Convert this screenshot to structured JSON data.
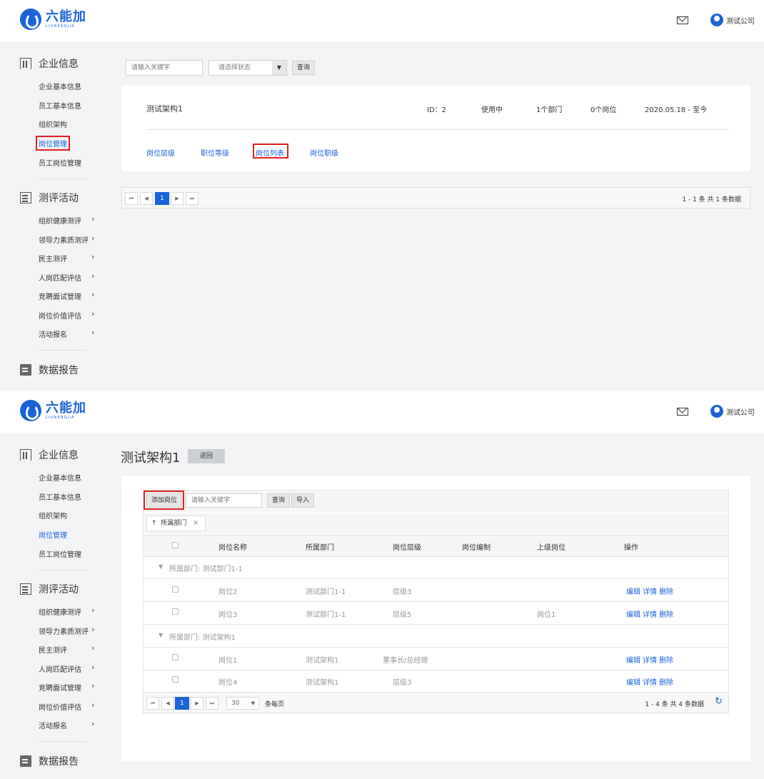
{
  "header": {
    "logo_cn": "六能加",
    "logo_en": "LIUNENGJIA",
    "user_name": "测试公司"
  },
  "sidebar": {
    "section1": {
      "title": "企业信息",
      "items": [
        "企业基本信息",
        "员工基本信息",
        "组织架构",
        "岗位管理",
        "员工岗位管理"
      ]
    },
    "section2": {
      "title": "测评活动",
      "items": [
        "组织健康测评",
        "领导力素质测评",
        "民主测评",
        "人岗匹配评估",
        "竞聘面试管理",
        "岗位价值评估",
        "活动报名"
      ]
    },
    "section3": {
      "title": "数据报告"
    },
    "chevron": "›"
  },
  "screen1": {
    "search_placeholder": "请输入关键字",
    "status_placeholder": "请选择状态",
    "query_label": "查询",
    "card": {
      "name": "测试架构1",
      "id": "ID：2",
      "status": "使用中",
      "departments": "1个部门",
      "positions": "0个岗位",
      "date": "2020.05.18 - 至今",
      "tabs": [
        "岗位层级",
        "职位等级",
        "岗位列表",
        "岗位职级"
      ]
    },
    "pager": {
      "page": "1",
      "summary": "1 - 1 条   共 1 条数据"
    }
  },
  "screen2": {
    "title": "测试架构1",
    "back_label": "返回",
    "add_label": "添加岗位",
    "search_placeholder": "请输入关键字",
    "query_label": "查询",
    "import_label": "导入",
    "group_chip": "所属部门",
    "columns": [
      "岗位名称",
      "所属部门",
      "岗位层级",
      "岗位编制",
      "上级岗位",
      "操作"
    ],
    "groups": [
      {
        "label": "所属部门: 测试部门1-1",
        "rows": [
          {
            "name": "岗位2",
            "dept": "测试部门1-1",
            "level": "层级3",
            "quota": "",
            "parent": ""
          },
          {
            "name": "岗位3",
            "dept": "测试部门1-1",
            "level": "层级5",
            "quota": "",
            "parent": "岗位1"
          }
        ]
      },
      {
        "label": "所属部门: 测试架构1",
        "rows": [
          {
            "name": "岗位1",
            "dept": "测试架构1",
            "level": "董事长/总经理",
            "quota": "",
            "parent": ""
          },
          {
            "name": "岗位4",
            "dept": "测试架构1",
            "level": "层级3",
            "quota": "",
            "parent": ""
          }
        ]
      }
    ],
    "ops": [
      "编辑",
      "详情",
      "删除"
    ],
    "pager": {
      "page": "1",
      "page_size": "30",
      "per_page_label": "条每页",
      "summary": "1 - 4 条   共 4 条数据"
    }
  }
}
